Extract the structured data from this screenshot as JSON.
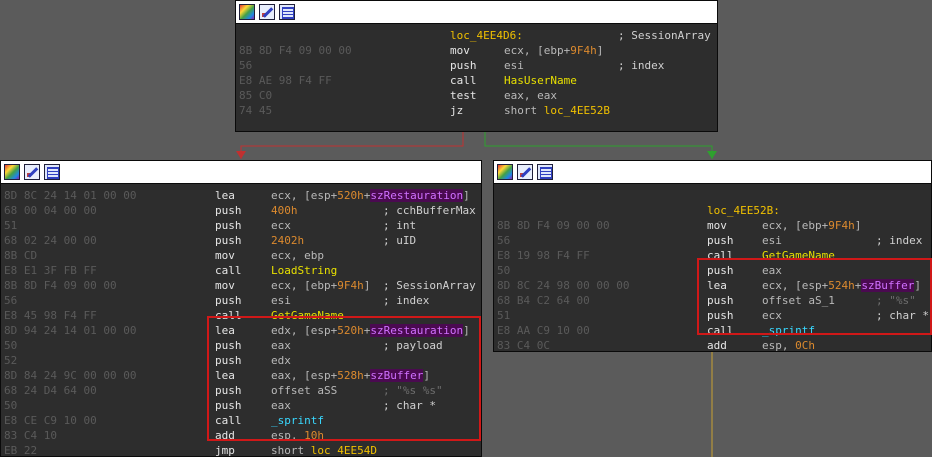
{
  "blocks": [
    {
      "id": "top",
      "lines": [
        {
          "b": "",
          "label": "loc_4EE4D6:",
          "c": "; SessionArray"
        },
        {
          "b": "8B 8D F4 09 00 00",
          "m": "mov",
          "o": [
            [
              "ecx, [ebp+",
              "r"
            ],
            [
              "9F4h",
              "n"
            ],
            [
              "]",
              "r"
            ]
          ]
        },
        {
          "b": "56",
          "m": "push",
          "o": [
            [
              "esi",
              "r"
            ]
          ],
          "c": "; index"
        },
        {
          "b": "E8 AE 98 F4 FF",
          "m": "call",
          "o": [
            [
              "HasUserName",
              "f"
            ]
          ]
        },
        {
          "b": "85 C0",
          "m": "test",
          "o": [
            [
              "eax, eax",
              "r"
            ]
          ]
        },
        {
          "b": "74 45",
          "m": "jz",
          "o": [
            [
              "short ",
              "r"
            ],
            [
              "loc_4EE52B",
              "l"
            ]
          ]
        }
      ]
    },
    {
      "id": "left",
      "lines": [
        {
          "b": "8D 8C 24 14 01 00 00",
          "m": "lea",
          "o": [
            [
              "ecx, [esp+",
              "r"
            ],
            [
              "520h",
              "n"
            ],
            [
              "+",
              "r"
            ],
            [
              "szRestauration",
              "v"
            ],
            [
              "]",
              "r"
            ]
          ]
        },
        {
          "b": "68 00 04 00 00",
          "m": "push",
          "o": [
            [
              "400h",
              "n"
            ]
          ],
          "c": "; cchBufferMax"
        },
        {
          "b": "51",
          "m": "push",
          "o": [
            [
              "ecx",
              "r"
            ]
          ],
          "c": "; int"
        },
        {
          "b": "68 02 24 00 00",
          "m": "push",
          "o": [
            [
              "2402h",
              "n"
            ]
          ],
          "c": "; uID"
        },
        {
          "b": "8B CD",
          "m": "mov",
          "o": [
            [
              "ecx, ebp",
              "r"
            ]
          ]
        },
        {
          "b": "E8 E1 3F FB FF",
          "m": "call",
          "o": [
            [
              "LoadString",
              "f"
            ]
          ]
        },
        {
          "b": "8B 8D F4 09 00 00",
          "m": "mov",
          "o": [
            [
              "ecx, [ebp+",
              "r"
            ],
            [
              "9F4h",
              "n"
            ],
            [
              "]",
              "r"
            ]
          ],
          "c": "; SessionArray"
        },
        {
          "b": "56",
          "m": "push",
          "o": [
            [
              "esi",
              "r"
            ]
          ],
          "c": "; index"
        },
        {
          "b": "E8 45 98 F4 FF",
          "m": "call",
          "o": [
            [
              "GetGameName",
              "f"
            ]
          ]
        },
        {
          "b": "8D 94 24 14 01 00 00",
          "m": "lea",
          "o": [
            [
              "edx, [esp+",
              "r"
            ],
            [
              "520h",
              "n"
            ],
            [
              "+",
              "r"
            ],
            [
              "szRestauration",
              "v"
            ],
            [
              "]",
              "r"
            ]
          ]
        },
        {
          "b": "50",
          "m": "push",
          "o": [
            [
              "eax",
              "r"
            ]
          ],
          "c": "; payload"
        },
        {
          "b": "52",
          "m": "push",
          "o": [
            [
              "edx",
              "r"
            ]
          ]
        },
        {
          "b": "8D 84 24 9C 00 00 00",
          "m": "lea",
          "o": [
            [
              "eax, [esp+",
              "r"
            ],
            [
              "528h",
              "n"
            ],
            [
              "+",
              "r"
            ],
            [
              "szBuffer",
              "v"
            ],
            [
              "]",
              "r"
            ]
          ]
        },
        {
          "b": "68 24 D4 64 00",
          "m": "push",
          "o": [
            [
              "offset aSS",
              "r"
            ]
          ],
          "c": "; \"%s %s\"",
          "cs": true
        },
        {
          "b": "50",
          "m": "push",
          "o": [
            [
              "eax",
              "r"
            ]
          ],
          "c": "; char *"
        },
        {
          "b": "E8 CE C9 10 00",
          "m": "call",
          "o": [
            [
              "_sprintf",
              "x"
            ]
          ]
        },
        {
          "b": "83 C4 10",
          "m": "add",
          "o": [
            [
              "esp, ",
              "r"
            ],
            [
              "10h",
              "n"
            ]
          ]
        },
        {
          "b": "EB 22",
          "m": "jmp",
          "o": [
            [
              "short ",
              "r"
            ],
            [
              "loc_4EE54D",
              "l"
            ]
          ]
        }
      ]
    },
    {
      "id": "right",
      "lines": [
        {
          "b": ""
        },
        {
          "b": "",
          "label": "loc_4EE52B:"
        },
        {
          "b": "8B 8D F4 09 00 00",
          "m": "mov",
          "o": [
            [
              "ecx, [ebp+",
              "r"
            ],
            [
              "9F4h",
              "n"
            ],
            [
              "]",
              "r"
            ]
          ]
        },
        {
          "b": "56",
          "m": "push",
          "o": [
            [
              "esi",
              "r"
            ]
          ],
          "c": "; index"
        },
        {
          "b": "E8 19 98 F4 FF",
          "m": "call",
          "o": [
            [
              "GetGameName",
              "f"
            ]
          ]
        },
        {
          "b": "50",
          "m": "push",
          "o": [
            [
              "eax",
              "r"
            ]
          ]
        },
        {
          "b": "8D 8C 24 98 00 00 00",
          "m": "lea",
          "o": [
            [
              "ecx, [esp+",
              "r"
            ],
            [
              "524h",
              "n"
            ],
            [
              "+",
              "r"
            ],
            [
              "szBuffer",
              "v"
            ],
            [
              "]",
              "r"
            ]
          ]
        },
        {
          "b": "68 B4 C2 64 00",
          "m": "push",
          "o": [
            [
              "offset aS_1",
              "r"
            ]
          ],
          "c": "; \"%s\"",
          "cs": true
        },
        {
          "b": "51",
          "m": "push",
          "o": [
            [
              "ecx",
              "r"
            ]
          ],
          "c": "; char *"
        },
        {
          "b": "E8 AA C9 10 00",
          "m": "call",
          "o": [
            [
              "_sprintf",
              "x"
            ]
          ]
        },
        {
          "b": "83 C4 0C",
          "m": "add",
          "o": [
            [
              "esp, ",
              "r"
            ],
            [
              "0Ch",
              "n"
            ]
          ]
        }
      ]
    }
  ],
  "icons": [
    "graph-view-icon",
    "edit-icon",
    "xrefs-icon"
  ],
  "colors": {
    "background": "#5b5b5b",
    "block": "#2d2d2d",
    "bytes": "#5a5a5a",
    "label": "#f0c000",
    "number": "#dc8a2e",
    "stack_var": "#d070ff",
    "function": "#e8e000",
    "library": "#39d8ff",
    "highlight_box": "#d01818",
    "edge_false": "#c03030",
    "edge_true": "#2ea02e",
    "edge_plain": "#c9a032"
  }
}
